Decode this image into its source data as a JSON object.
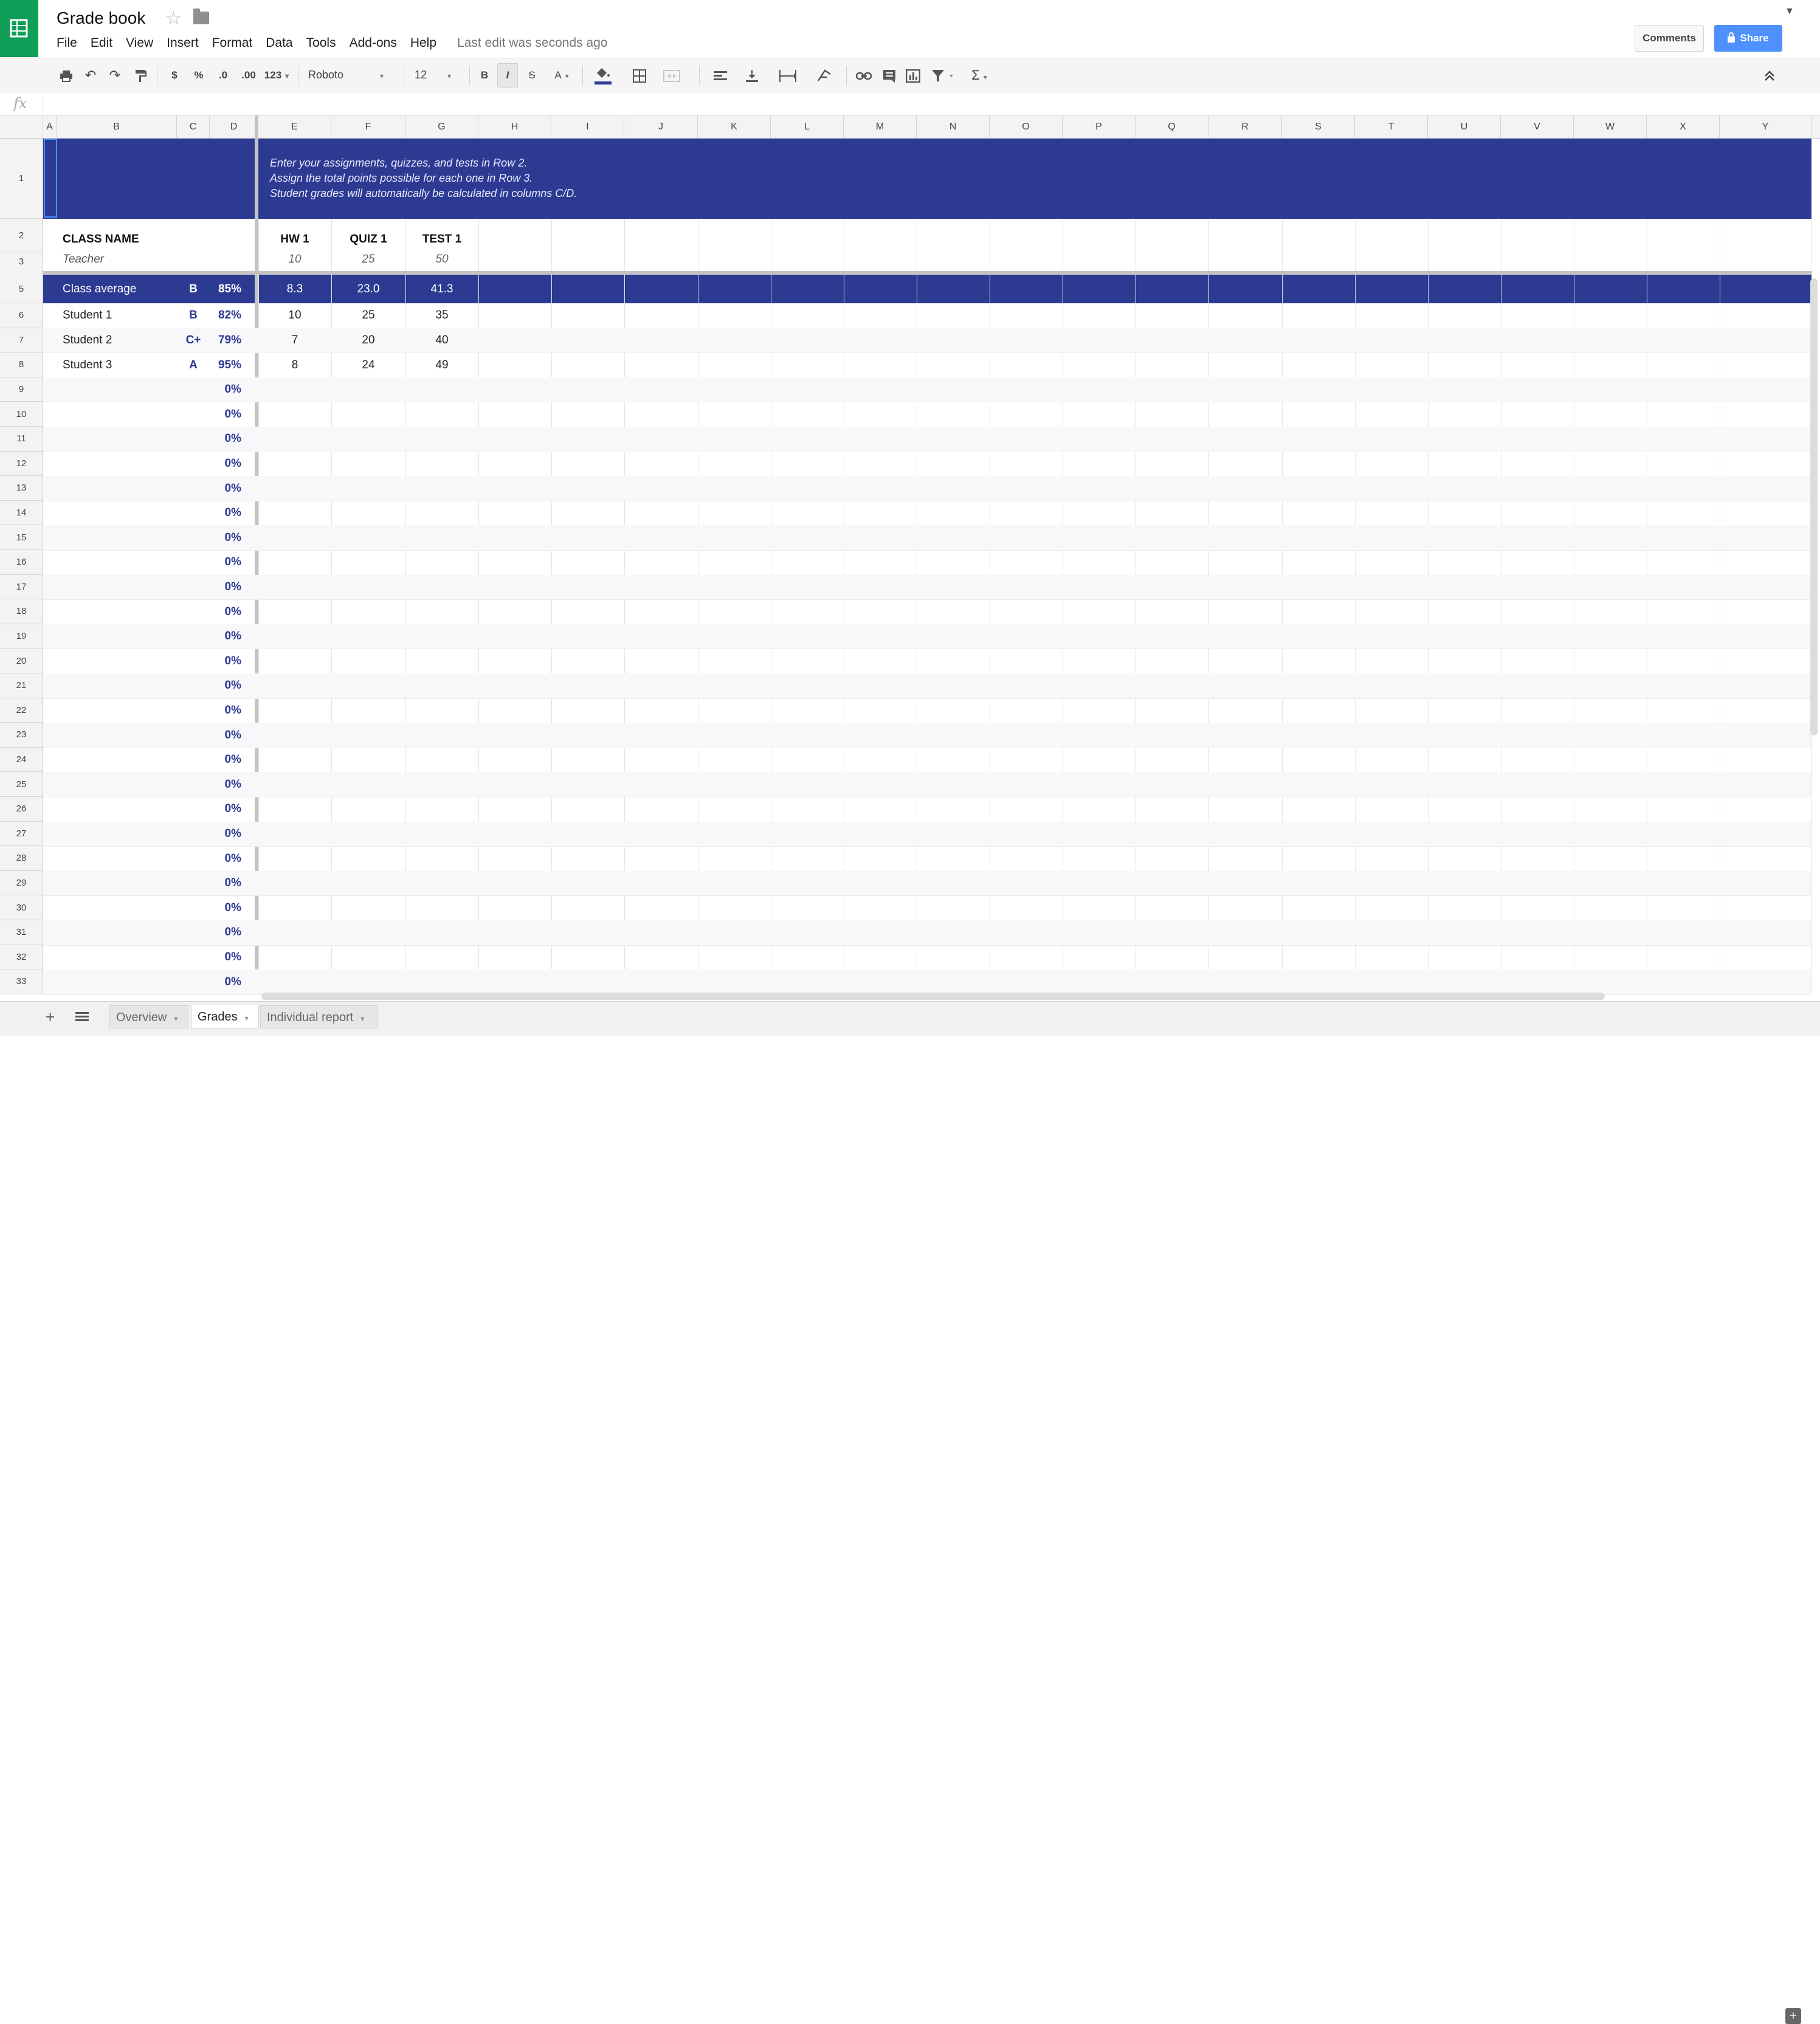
{
  "app": {
    "title": "Grade book",
    "menu": [
      "File",
      "Edit",
      "View",
      "Insert",
      "Format",
      "Data",
      "Tools",
      "Add-ons",
      "Help"
    ],
    "last_edit": "Last edit was seconds ago",
    "comments_label": "Comments",
    "share_label": "Share"
  },
  "toolbar": {
    "currency_label": "$",
    "percent_label": "%",
    "decrease_decimal_label": ".0",
    "increase_decimal_label": ".00",
    "more_formats_label": "123",
    "font_name": "Roboto",
    "font_size": "12",
    "bold_label": "B",
    "italic_label": "I",
    "strike_label": "S",
    "text_color_label": "A",
    "functions_label": "Σ"
  },
  "formula_bar": {
    "fx_label": "fx",
    "value": ""
  },
  "columns": [
    "A",
    "B",
    "C",
    "D",
    "E",
    "F",
    "G",
    "H",
    "I",
    "J",
    "K",
    "L",
    "M",
    "N",
    "O",
    "P",
    "Q",
    "R",
    "S",
    "T",
    "U",
    "V",
    "W",
    "X",
    "Y"
  ],
  "instructions": [
    "Enter your assignments, quizzes, and tests in Row 2.",
    "Assign the total points possible for each one in Row 3.",
    "Student grades will automatically be calculated in columns C/D."
  ],
  "class_info": {
    "class_name": "CLASS NAME",
    "teacher": "Teacher"
  },
  "assignments": [
    {
      "name": "HW 1",
      "points": "10"
    },
    {
      "name": "QUIZ 1",
      "points": "25"
    },
    {
      "name": "TEST 1",
      "points": "50"
    }
  ],
  "rows": [
    {
      "row_num": "5",
      "name": "Class average",
      "letter": "B",
      "percent": "85%",
      "scores": [
        "8.3",
        "23.0",
        "41.3"
      ]
    },
    {
      "row_num": "6",
      "name": "Student 1",
      "letter": "B",
      "percent": "82%",
      "scores": [
        "10",
        "25",
        "35"
      ]
    },
    {
      "row_num": "7",
      "name": "Student 2",
      "letter": "C+",
      "percent": "79%",
      "scores": [
        "7",
        "20",
        "40"
      ]
    },
    {
      "row_num": "8",
      "name": "Student 3",
      "letter": "A",
      "percent": "95%",
      "scores": [
        "8",
        "24",
        "49"
      ]
    },
    {
      "row_num": "9",
      "percent": "0%"
    },
    {
      "row_num": "10",
      "percent": "0%"
    },
    {
      "row_num": "11",
      "percent": "0%"
    },
    {
      "row_num": "12",
      "percent": "0%"
    },
    {
      "row_num": "13",
      "percent": "0%"
    },
    {
      "row_num": "14",
      "percent": "0%"
    },
    {
      "row_num": "15",
      "percent": "0%"
    },
    {
      "row_num": "16",
      "percent": "0%"
    },
    {
      "row_num": "17",
      "percent": "0%"
    },
    {
      "row_num": "18",
      "percent": "0%"
    },
    {
      "row_num": "19",
      "percent": "0%"
    },
    {
      "row_num": "20",
      "percent": "0%"
    },
    {
      "row_num": "21",
      "percent": "0%"
    },
    {
      "row_num": "22",
      "percent": "0%"
    },
    {
      "row_num": "23",
      "percent": "0%"
    },
    {
      "row_num": "24",
      "percent": "0%"
    },
    {
      "row_num": "25",
      "percent": "0%"
    },
    {
      "row_num": "26",
      "percent": "0%"
    },
    {
      "row_num": "27",
      "percent": "0%"
    },
    {
      "row_num": "28",
      "percent": "0%"
    },
    {
      "row_num": "29",
      "percent": "0%"
    },
    {
      "row_num": "30",
      "percent": "0%"
    },
    {
      "row_num": "31",
      "percent": "0%"
    },
    {
      "row_num": "32",
      "percent": "0%"
    },
    {
      "row_num": "33",
      "percent": "0%"
    }
  ],
  "header_row_nums": [
    "1",
    "2",
    "3"
  ],
  "sheets": [
    {
      "name": "Overview",
      "active": false
    },
    {
      "name": "Grades",
      "active": true
    },
    {
      "name": "Individual report",
      "active": false
    }
  ],
  "colors": {
    "band": "#2c3a92",
    "brand_green": "#0f9d58",
    "share_blue": "#4d90fe",
    "accent_text": "#2c3a92"
  }
}
